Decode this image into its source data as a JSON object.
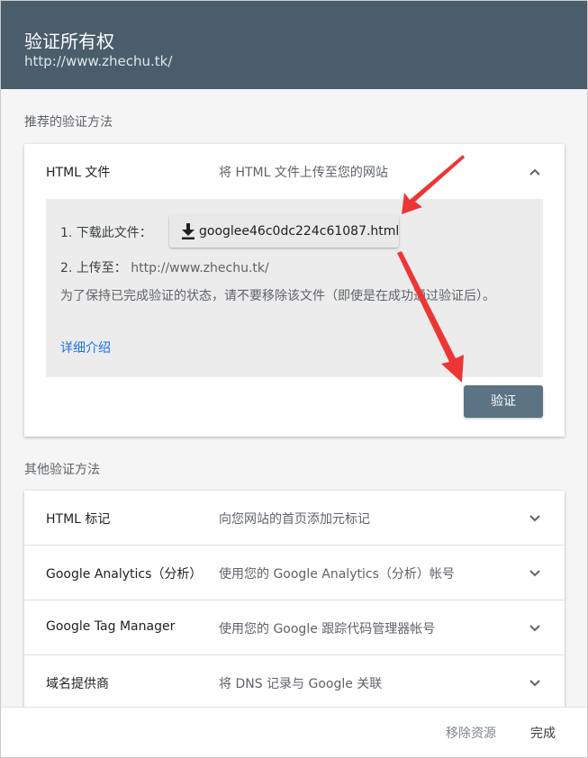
{
  "header": {
    "title": "验证所有权",
    "url": "http://www.zhechu.tk/"
  },
  "recommended": {
    "label": "推荐的验证方法",
    "method": {
      "name": "HTML 文件",
      "desc": "将 HTML 文件上传至您的网站",
      "step1_label": "1. 下载此文件：",
      "file_name": "googlee46c0dc224c61087.html",
      "step2_label": "2. 上传至：",
      "upload_url": "http://www.zhechu.tk/",
      "note": "为了保持已完成验证的状态，请不要移除该文件（即使是在成功通过验证后）。",
      "more_link": "详细介绍",
      "verify_button": "验证"
    }
  },
  "other": {
    "label": "其他验证方法",
    "methods": [
      {
        "name": "HTML 标记",
        "desc": "向您网站的首页添加元标记"
      },
      {
        "name": "Google Analytics（分析）",
        "desc": "使用您的 Google Analytics（分析）帐号"
      },
      {
        "name": "Google Tag Manager",
        "desc": "使用您的 Google 跟踪代码管理器帐号"
      },
      {
        "name": "域名提供商",
        "desc": "将 DNS 记录与 Google 关联"
      }
    ]
  },
  "footer": {
    "remove": "移除资源",
    "done": "完成"
  },
  "colors": {
    "header_bg": "#4a5d6b",
    "verify_bg": "#5b7383",
    "link": "#1a73e8",
    "annotation_arrow": "#ee3535"
  },
  "icons": {
    "download": "download-icon",
    "expanded": "chevron-up-icon",
    "collapsed": "chevron-down-icon"
  }
}
